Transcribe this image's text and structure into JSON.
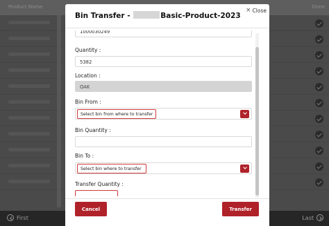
{
  "background": {
    "header_left": "Product Name",
    "header_right": "Done",
    "footer_first": "First",
    "footer_last": "Last"
  },
  "modal": {
    "title_prefix": "Bin Transfer - ",
    "title_suffix": "Basic-Product-2023",
    "close_label": "Close",
    "top_value": "1000030249",
    "fields": {
      "quantity_label": "Quantity :",
      "quantity_value": "5382",
      "location_label": "Location :",
      "location_value": "OAK",
      "bin_from_label": "Bin From :",
      "bin_from_placeholder": "Select bin from where to transfer",
      "bin_quantity_label": "Bin Quantity :",
      "bin_quantity_value": "",
      "bin_to_label": "Bin To :",
      "bin_to_placeholder": "Select bin where to transfer",
      "transfer_quantity_label": "Transfer Quantity :",
      "transfer_quantity_value": ""
    },
    "buttons": {
      "cancel": "Cancel",
      "transfer": "Transfer"
    }
  },
  "colors": {
    "accent": "#b0222a",
    "error_border": "#d03a3a"
  }
}
